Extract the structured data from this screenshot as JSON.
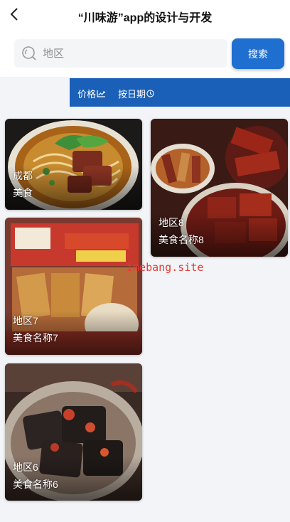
{
  "header": {
    "title": "“川味游”app的设计与开发"
  },
  "search": {
    "placeholder": "地区",
    "button_label": "搜索"
  },
  "sort": {
    "price_label": "价格",
    "date_label": "按日期"
  },
  "cards": [
    {
      "line1": "成都",
      "line2": "美食"
    },
    {
      "line1": "地区8",
      "line2": "美食名称8"
    },
    {
      "line1": "地区7",
      "line2": "美食名称7"
    },
    {
      "line1": "地区6",
      "line2": "美食名称6"
    }
  ],
  "watermark": "imebang.site",
  "colors": {
    "accent": "#1f6fd0",
    "sort_bar": "#1a5fb8",
    "watermark": "#e53935"
  },
  "icons": {
    "back": "chevron-left-icon",
    "search": "search-icon",
    "price": "trend-chart-icon",
    "date": "clock-icon"
  }
}
